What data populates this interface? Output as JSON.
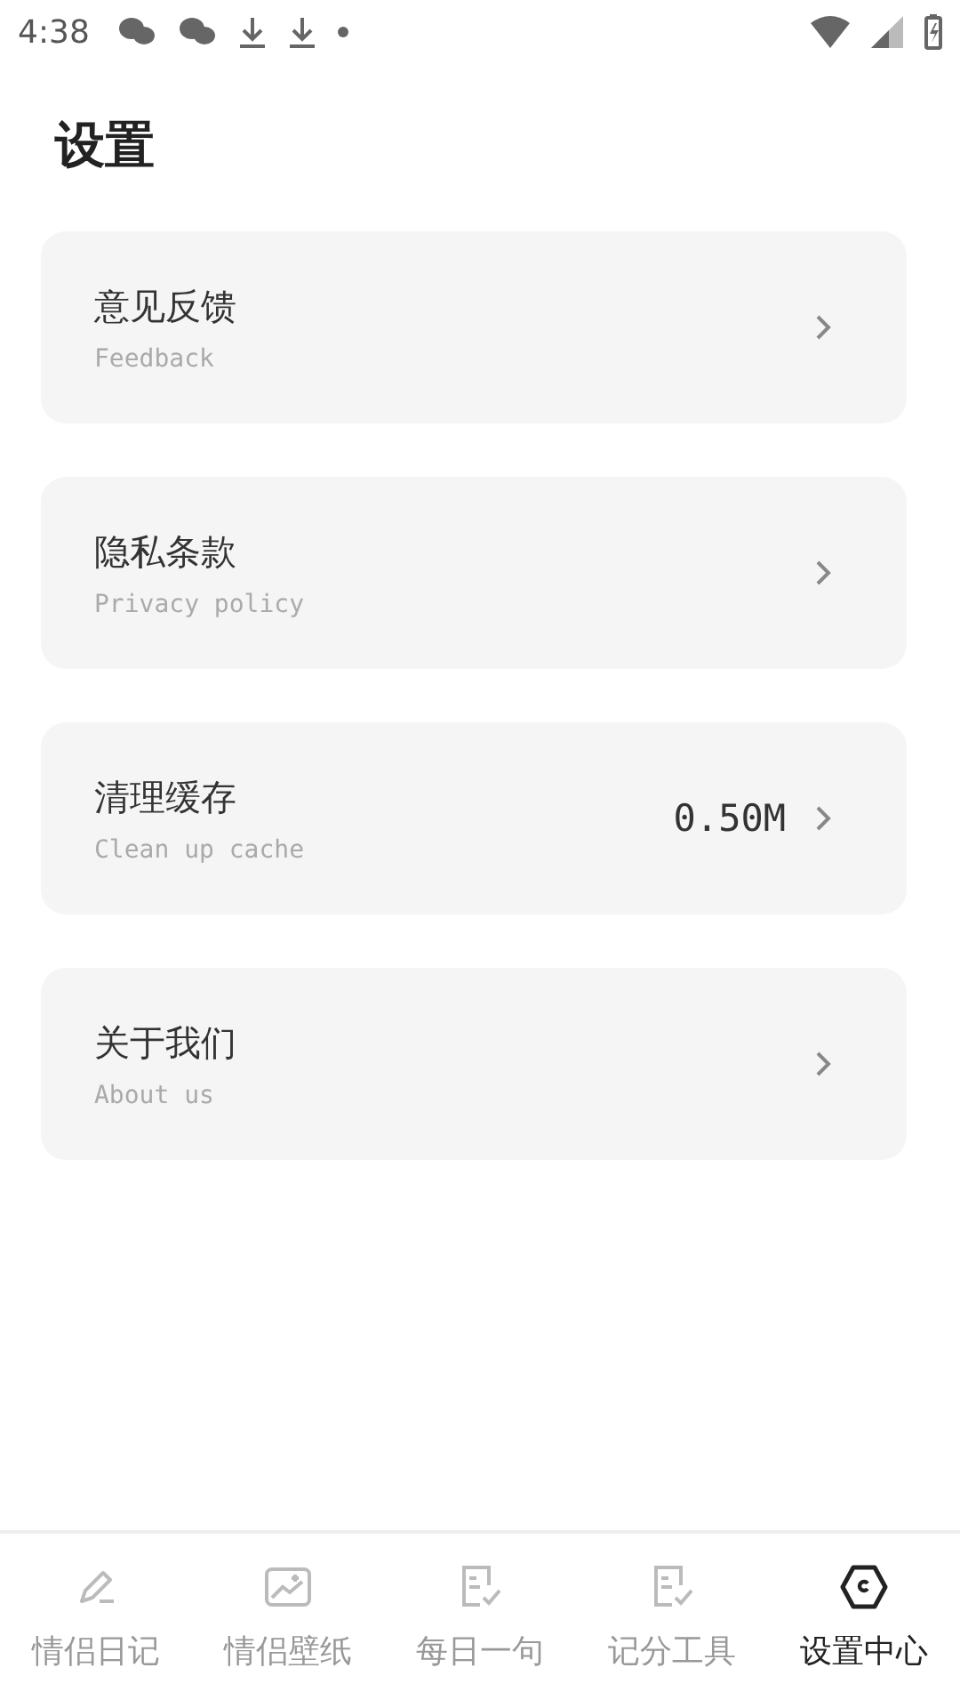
{
  "status_bar": {
    "time": "4:38"
  },
  "title": "设置",
  "items": [
    {
      "title": "意见反馈",
      "subtitle": "Feedback"
    },
    {
      "title": "隐私条款",
      "subtitle": "Privacy policy"
    },
    {
      "title": "清理缓存",
      "subtitle": "Clean up cache",
      "value": "0.50M"
    },
    {
      "title": "关于我们",
      "subtitle": "About us"
    }
  ],
  "tabs": [
    {
      "label": "情侣日记",
      "kind": "pen",
      "selected": false
    },
    {
      "label": "情侣壁纸",
      "kind": "image",
      "selected": false
    },
    {
      "label": "每日一句",
      "kind": "doc",
      "selected": false
    },
    {
      "label": "记分工具",
      "kind": "doc",
      "selected": false
    },
    {
      "label": "设置中心",
      "kind": "hex",
      "selected": true
    }
  ]
}
